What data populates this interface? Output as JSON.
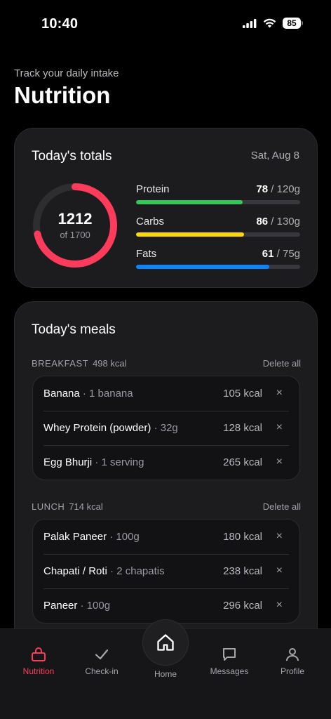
{
  "status_bar": {
    "time": "10:40",
    "battery": "85"
  },
  "header": {
    "subtitle": "Track your daily intake",
    "title": "Nutrition"
  },
  "totals": {
    "title": "Today's totals",
    "date": "Sat, Aug 8",
    "calories": {
      "value": "1212",
      "goal_text": "of 1700",
      "progress": 0.713,
      "color": "#ff3b5c"
    },
    "macros": [
      {
        "label": "Protein",
        "current": "78",
        "goal": " / 120g",
        "progress": 0.65,
        "color": "#34c759"
      },
      {
        "label": "Carbs",
        "current": "86",
        "goal": " / 130g",
        "progress": 0.66,
        "color": "#ffd60a"
      },
      {
        "label": "Fats",
        "current": "61",
        "goal": " / 75g",
        "progress": 0.81,
        "color": "#0a84ff"
      }
    ]
  },
  "meals": {
    "title": "Today's meals",
    "sections": [
      {
        "name": "BREAKFAST",
        "kcal": "498 kcal",
        "delete_label": "Delete all",
        "items": [
          {
            "name": "Banana",
            "portion": " · 1 banana",
            "kcal": "105 kcal",
            "remove": "×"
          },
          {
            "name": "Whey Protein (powder)",
            "portion": " · 32g",
            "kcal": "128 kcal",
            "remove": "×"
          },
          {
            "name": "Egg Bhurji",
            "portion": " · 1 serving",
            "kcal": "265 kcal",
            "remove": "×"
          }
        ]
      },
      {
        "name": "LUNCH",
        "kcal": "714 kcal",
        "delete_label": "Delete all",
        "items": [
          {
            "name": "Palak Paneer",
            "portion": " · 100g",
            "kcal": "180 kcal",
            "remove": "×"
          },
          {
            "name": "Chapati / Roti",
            "portion": " · 2 chapatis",
            "kcal": "238 kcal",
            "remove": "×"
          },
          {
            "name": "Paneer",
            "portion": " · 100g",
            "kcal": "296 kcal",
            "remove": "×"
          }
        ]
      }
    ]
  },
  "tab_bar": {
    "tabs": [
      {
        "label": "Nutrition",
        "icon": "lock-bag-icon",
        "active": true
      },
      {
        "label": "Check-in",
        "icon": "checkmark-icon",
        "active": false
      },
      {
        "label": "Home",
        "icon": "home-icon",
        "active": false
      },
      {
        "label": "Messages",
        "icon": "chat-icon",
        "active": false
      },
      {
        "label": "Profile",
        "icon": "person-icon",
        "active": false
      }
    ],
    "active_color": "#ff3b5c"
  }
}
